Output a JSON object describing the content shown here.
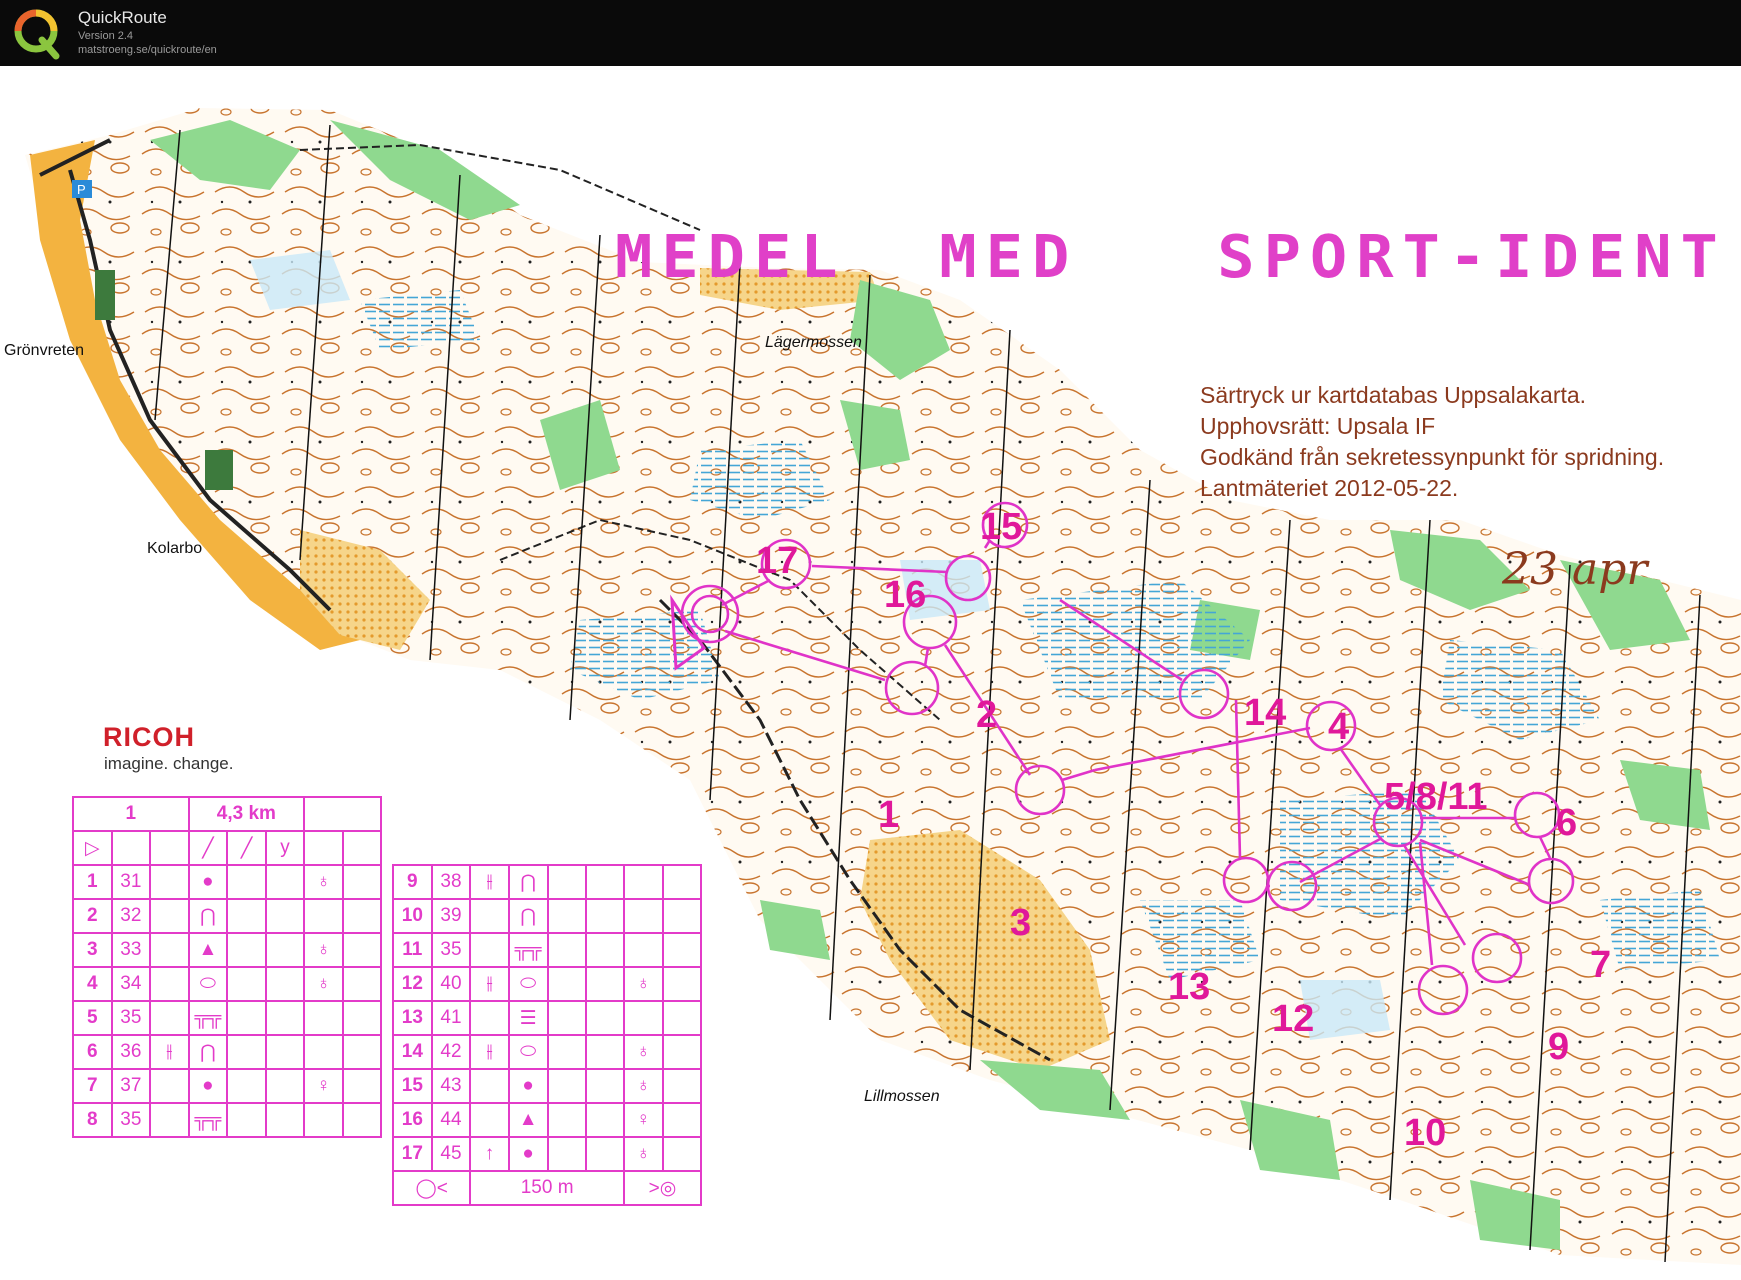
{
  "app": {
    "name": "QuickRoute",
    "version": "Version 2.4",
    "url": "matstroeng.se/quickroute/en"
  },
  "map": {
    "course_title": "MEDEL  MED   SPORT-IDENT",
    "copyright": [
      "Särtryck ur kartdatabas Uppsalakarta.",
      "Upphovsrätt: Upsala IF",
      "Godkänd från sekretessynpunkt för spridning.",
      "Lantmäteriet 2012-05-22."
    ],
    "handwritten_date": "23 apr",
    "place_names": {
      "gronvreten": "Grönvreten",
      "kolarbo": "Kolarbo",
      "lagermossen": "Lägermossen",
      "lillmossen": "Lillmossen"
    },
    "sponsor": {
      "name": "RICOH",
      "slogan": "imagine. change."
    },
    "parking_symbol": "P",
    "controls": [
      "1",
      "2",
      "3",
      "4",
      "5/8/11",
      "6",
      "7",
      "9",
      "10",
      "12",
      "13",
      "14",
      "15",
      "16",
      "17"
    ],
    "colors": {
      "course": "#e033c8",
      "contour": "#c8742e",
      "vegetation": "#7fd47f",
      "open_land": "#f3b340",
      "water": "#7ec8e8"
    }
  },
  "description_sheet": {
    "header": {
      "course": "1",
      "length": "4,3 km"
    },
    "start_symbol": "▷",
    "start_symbols": [
      "╱",
      "╱",
      "y"
    ],
    "rows_left": [
      {
        "n": "1",
        "code": "31",
        "c": "",
        "d": "●",
        "e": "",
        "f": "",
        "g": "♁",
        "h": ""
      },
      {
        "n": "2",
        "code": "32",
        "c": "",
        "d": "⋂",
        "e": "",
        "f": "",
        "g": "",
        "h": ""
      },
      {
        "n": "3",
        "code": "33",
        "c": "",
        "d": "▲",
        "e": "",
        "f": "",
        "g": "♁",
        "h": ""
      },
      {
        "n": "4",
        "code": "34",
        "c": "",
        "d": "⬭",
        "e": "",
        "f": "",
        "g": "♁",
        "h": ""
      },
      {
        "n": "5",
        "code": "35",
        "c": "",
        "d": "╦╦",
        "e": "",
        "f": "",
        "g": "",
        "h": ""
      },
      {
        "n": "6",
        "code": "36",
        "c": "⫲",
        "d": "⋂",
        "e": "",
        "f": "",
        "g": "",
        "h": ""
      },
      {
        "n": "7",
        "code": "37",
        "c": "",
        "d": "●",
        "e": "",
        "f": "",
        "g": "♀",
        "h": ""
      },
      {
        "n": "8",
        "code": "35",
        "c": "",
        "d": "╦╦",
        "e": "",
        "f": "",
        "g": "",
        "h": ""
      }
    ],
    "rows_right": [
      {
        "n": "9",
        "code": "38",
        "c": "⫲",
        "d": "⋂",
        "e": "",
        "f": "",
        "g": "",
        "h": ""
      },
      {
        "n": "10",
        "code": "39",
        "c": "",
        "d": "⋂",
        "e": "",
        "f": "",
        "g": "",
        "h": ""
      },
      {
        "n": "11",
        "code": "35",
        "c": "",
        "d": "╦╦",
        "e": "",
        "f": "",
        "g": "",
        "h": ""
      },
      {
        "n": "12",
        "code": "40",
        "c": "⫲",
        "d": "⬭",
        "e": "",
        "f": "",
        "g": "♁",
        "h": ""
      },
      {
        "n": "13",
        "code": "41",
        "c": "",
        "d": "☰",
        "e": "",
        "f": "",
        "g": "",
        "h": ""
      },
      {
        "n": "14",
        "code": "42",
        "c": "⫲",
        "d": "⬭",
        "e": "",
        "f": "",
        "g": "♁",
        "h": ""
      },
      {
        "n": "15",
        "code": "43",
        "c": "",
        "d": "●",
        "e": "",
        "f": "",
        "g": "♁",
        "h": ""
      },
      {
        "n": "16",
        "code": "44",
        "c": "",
        "d": "▲",
        "e": "",
        "f": "",
        "g": "♀",
        "h": ""
      },
      {
        "n": "17",
        "code": "45",
        "c": "↑",
        "d": "●",
        "e": "",
        "f": "",
        "g": "♁",
        "h": ""
      }
    ],
    "finish": {
      "left_symbol": "◯<",
      "distance": "150 m",
      "right_symbol": ">◎"
    }
  }
}
